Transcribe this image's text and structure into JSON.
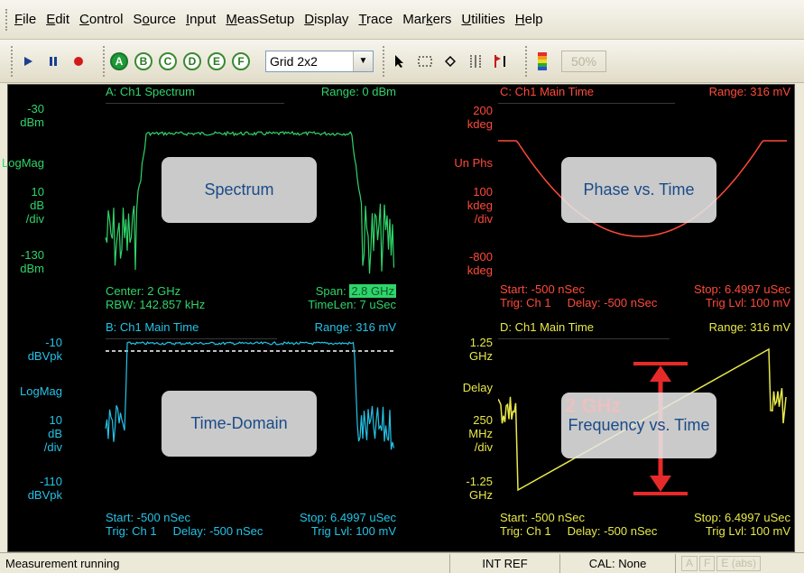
{
  "menu": [
    {
      "label": "File",
      "underline": "F",
      "rest": "ile"
    },
    {
      "label": "Edit",
      "underline": "E",
      "rest": "dit"
    },
    {
      "label": "Control",
      "underline": "C",
      "rest": "ontrol"
    },
    {
      "label": "Source",
      "underline": "o",
      "pre": "S",
      "rest": "urce"
    },
    {
      "label": "Input",
      "underline": "I",
      "rest": "nput"
    },
    {
      "label": "MeasSetup",
      "underline": "M",
      "rest": "easSetup"
    },
    {
      "label": "Display",
      "underline": "D",
      "rest": "isplay"
    },
    {
      "label": "Trace",
      "underline": "T",
      "rest": "race"
    },
    {
      "label": "Markers",
      "underline": "k",
      "pre": "Mar",
      "rest": "ers"
    },
    {
      "label": "Utilities",
      "underline": "U",
      "rest": "tilities"
    },
    {
      "label": "Help",
      "underline": "H",
      "rest": "elp"
    }
  ],
  "toolbar": {
    "trace_buttons": [
      "A",
      "B",
      "C",
      "D",
      "E",
      "F"
    ],
    "active_trace": "A",
    "grid_layout": "Grid 2x2",
    "percent": "50%"
  },
  "panels": {
    "a": {
      "title": "A: Ch1 Spectrum",
      "range": "Range: 0 dBm",
      "ylabels": [
        "-30\ndBm",
        "LogMag",
        "10\ndB\n/div",
        "-130\ndBm"
      ],
      "footer_left1": "Center: 2 GHz",
      "footer_left2": "RBW: 142.857 kHz",
      "footer_right1_label": "Span:",
      "footer_right1_value": "2.8 GHz",
      "footer_right2": "TimeLen: 7 uSec",
      "callout": "Spectrum",
      "color": "#2fd46a"
    },
    "b": {
      "title": "B: Ch1 Main Time",
      "range": "Range: 316 mV",
      "ylabels": [
        "-10\ndBVpk",
        "LogMag",
        "10\ndB\n/div",
        "-110\ndBVpk"
      ],
      "footer_left1": "Start: -500 nSec",
      "footer_left2": "Trig: Ch 1     Delay: -500 nSec",
      "footer_right1": "Stop: 6.4997 uSec",
      "footer_right2": "Trig Lvl: 100 mV",
      "callout": "Time-Domain",
      "color": "#25c3e6"
    },
    "c": {
      "title": "C: Ch1 Main Time",
      "range": "Range: 316 mV",
      "ylabels": [
        "200\nkdeg",
        "Un Phs",
        "100\nkdeg\n/div",
        "-800\nkdeg"
      ],
      "footer_left1": "Start: -500 nSec",
      "footer_left2": "Trig: Ch 1     Delay: -500 nSec",
      "footer_right1": "Stop: 6.4997 uSec",
      "footer_right2": "Trig Lvl: 100 mV",
      "callout": "Phase vs. Time",
      "color": "#ff4a3a"
    },
    "d": {
      "title": "D: Ch1 Main Time",
      "range": "Range: 316 mV",
      "ylabels": [
        "1.25\nGHz",
        "Delay",
        "250\nMHz\n/div",
        "-1.25\nGHz"
      ],
      "footer_left1": "Start: -500 nSec",
      "footer_left2": "Trig: Ch 1     Delay: -500 nSec",
      "footer_right1": "Stop: 6.4997 uSec",
      "footer_right2": "Trig Lvl: 100 mV",
      "callout": "Frequency vs. Time",
      "annotation": "2 GHz",
      "color": "#e8e84a"
    }
  },
  "status": {
    "message": "Measurement running",
    "ref": "INT REF",
    "cal": "CAL: None",
    "indicators": [
      "A",
      "F",
      "E (abs)"
    ]
  }
}
